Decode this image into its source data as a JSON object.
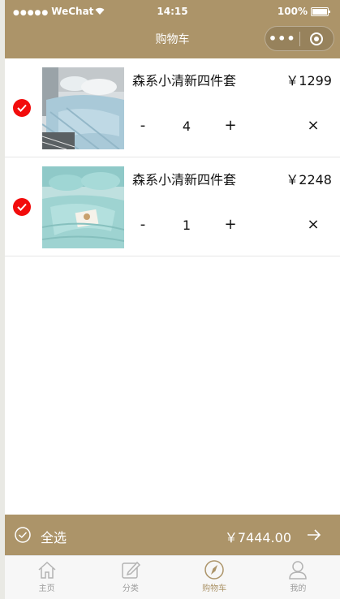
{
  "status": {
    "carrier": "WeChat",
    "time": "14:15",
    "battery": "100%"
  },
  "nav": {
    "title": "购物车"
  },
  "cart": {
    "items": [
      {
        "name": "森系小清新四件套",
        "price": "￥1299",
        "quantity": "4",
        "minus": "-",
        "plus": "+",
        "remove": "×",
        "checked": true
      },
      {
        "name": "森系小清新四件套",
        "price": "￥2248",
        "quantity": "1",
        "minus": "-",
        "plus": "+",
        "remove": "×",
        "checked": true
      }
    ]
  },
  "footer": {
    "select_all": "全选",
    "total": "￥7444.00"
  },
  "tabs": [
    {
      "label": "主页",
      "icon": "home-icon"
    },
    {
      "label": "分类",
      "icon": "edit-icon"
    },
    {
      "label": "购物车",
      "icon": "compass-icon",
      "active": true
    },
    {
      "label": "我的",
      "icon": "user-icon"
    }
  ],
  "colors": {
    "brand": "#ac9469",
    "check": "#f20c0c"
  }
}
